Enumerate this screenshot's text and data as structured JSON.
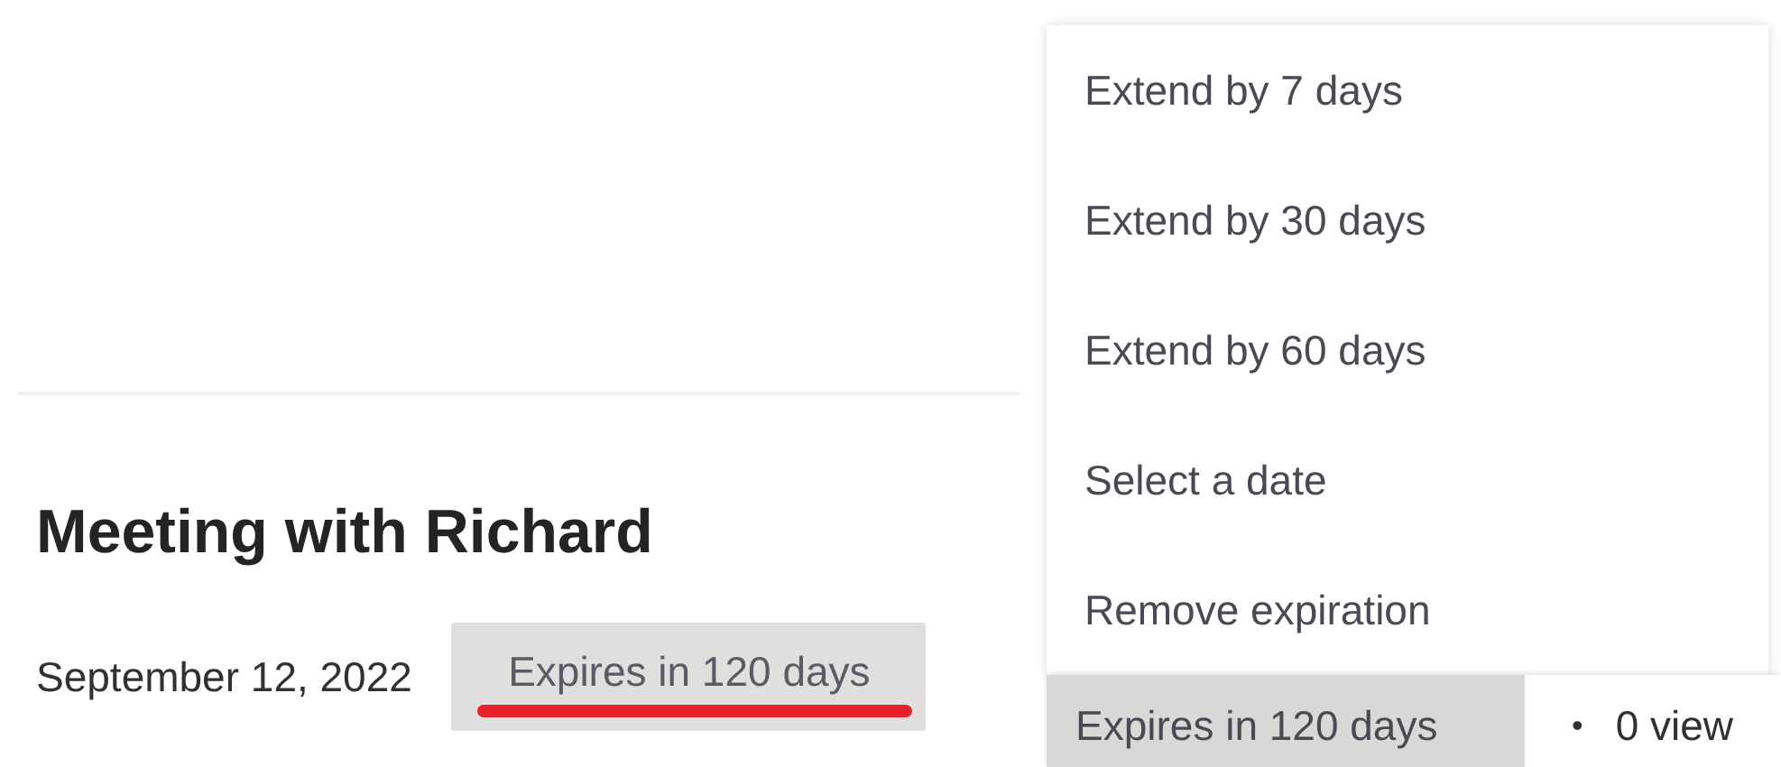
{
  "document": {
    "title": "Meeting with Richard",
    "date": "September 12, 2022",
    "expiry_button": {
      "label": "Expires in 120 days",
      "underlined_in_red": true
    }
  },
  "expiry_menu": {
    "items": [
      {
        "label": "Extend by 7 days"
      },
      {
        "label": "Extend by 30 days"
      },
      {
        "label": "Extend by 60 days"
      },
      {
        "label": "Select a date"
      },
      {
        "label": "Remove expiration"
      }
    ],
    "anchor_button": {
      "label": "Expires in 120 days"
    },
    "separator": "•",
    "views": "0 view"
  }
}
